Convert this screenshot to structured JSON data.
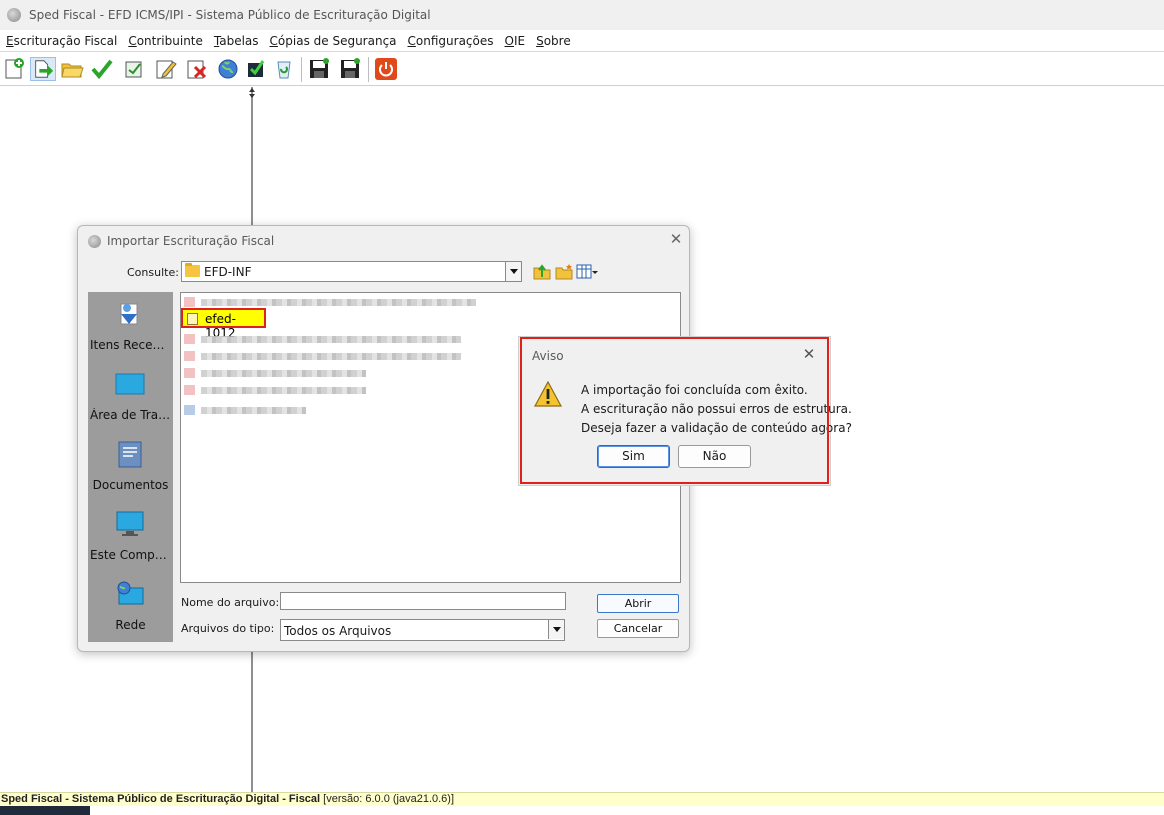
{
  "window": {
    "title": "Sped Fiscal - EFD ICMS/IPI - Sistema Público de Escrituração Digital"
  },
  "menu": [
    "Escrituração Fiscal",
    "Contribuinte",
    "Tabelas",
    "Cópias de Segurança",
    "Configurações",
    "OIE",
    "Sobre"
  ],
  "toolbar": {
    "icons": [
      "new-file-icon",
      "import-arrow-icon",
      "open-folder-icon",
      "validate-check-icon",
      "sign-icon",
      "edit-pencil-icon",
      "delete-icon",
      "globe-icon",
      "transmit-icon",
      "recycle-icon",
      "save-backup-icon",
      "restore-backup-icon",
      "power-icon"
    ]
  },
  "status": {
    "bold": "Sped Fiscal - Sistema Público de Escrituração Digital - Fiscal",
    "version": " [versão: 6.0.0 (java21.0.6)]"
  },
  "import_dialog": {
    "title": "Importar Escrituração Fiscal",
    "look_in_label": "Consulte:",
    "look_in_value": "EFD-INF",
    "places": [
      "Itens Recentes",
      "Área de Trabalho",
      "Documentos",
      "Este Computador",
      "Rede"
    ],
    "selected_file": "efed-1012",
    "file_name_label": "Nome do arquivo:",
    "file_name_value": "",
    "file_type_label": "Arquivos do tipo:",
    "file_type_value": "Todos os Arquivos",
    "open_button": "Abrir",
    "cancel_button": "Cancelar"
  },
  "aviso": {
    "title": "Aviso",
    "lines": [
      "A importação foi concluída com êxito.",
      "A escrituração não possui erros de estrutura.",
      "Deseja fazer a validação de conteúdo agora?"
    ],
    "yes": "Sim",
    "no": "Não"
  },
  "colors": {
    "highlight": "#ffff00",
    "outline": "#e0201c",
    "statusbar": "#ffffcc"
  }
}
